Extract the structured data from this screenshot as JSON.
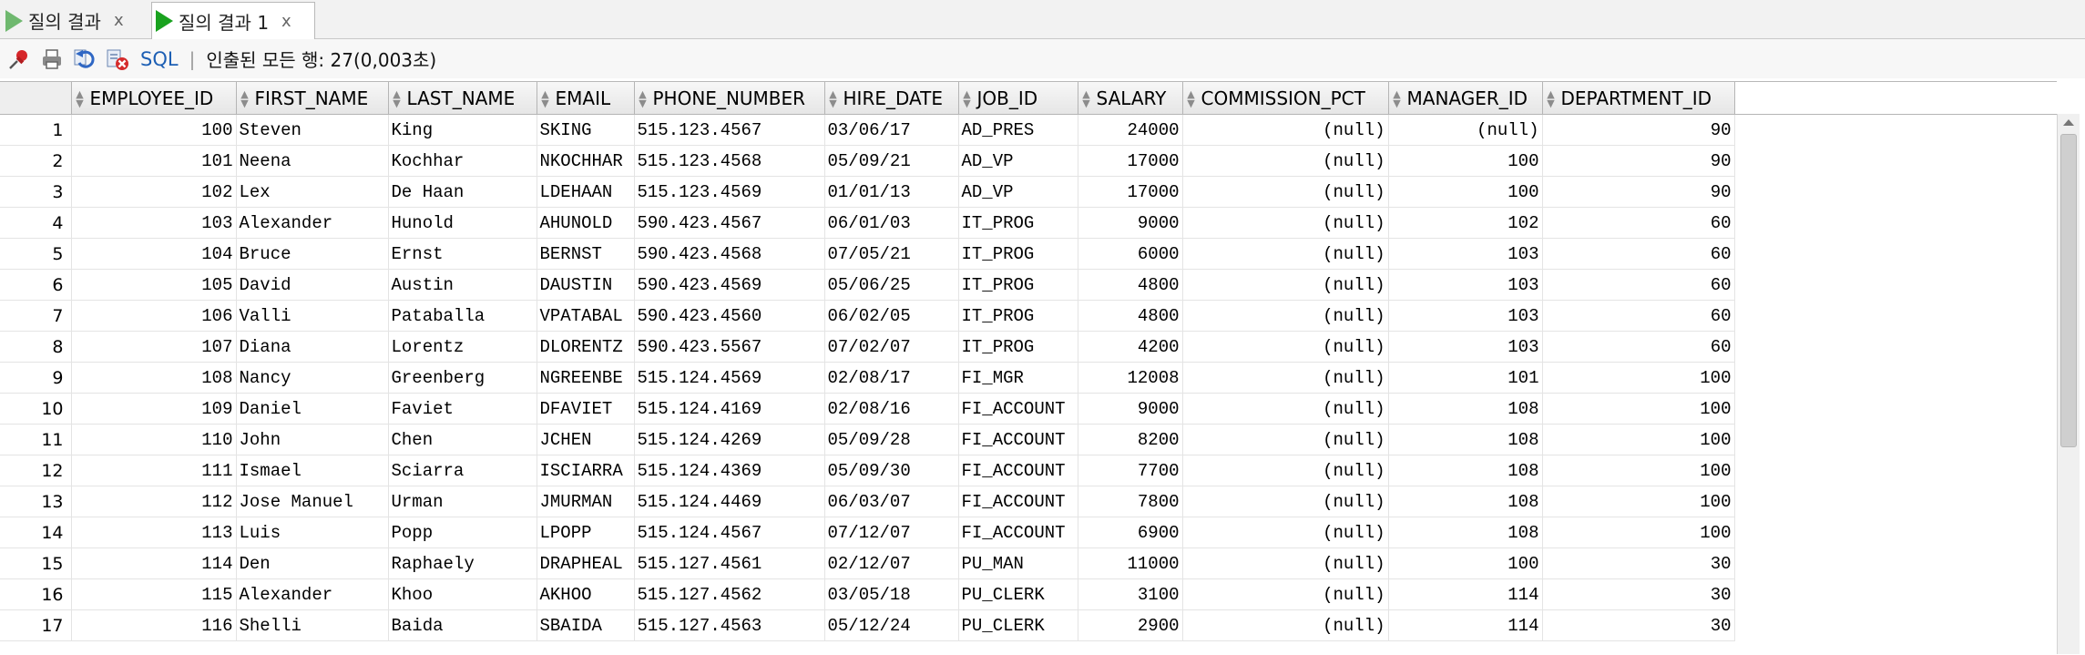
{
  "tabs": [
    {
      "label": "질의 결과",
      "close": "x"
    },
    {
      "label": "질의 결과 1",
      "close": "x"
    }
  ],
  "toolbar": {
    "sql_label": "SQL",
    "separator": "|",
    "status": "인출된 모든 행: 27(0,003초)",
    "icons": [
      "pin-icon",
      "print-icon",
      "refresh-icon",
      "clear-icon"
    ]
  },
  "grid": {
    "columns": [
      "EMPLOYEE_ID",
      "FIRST_NAME",
      "LAST_NAME",
      "EMAIL",
      "PHONE_NUMBER",
      "HIRE_DATE",
      "JOB_ID",
      "SALARY",
      "COMMISSION_PCT",
      "MANAGER_ID",
      "DEPARTMENT_ID"
    ],
    "rows": [
      [
        "1",
        "100",
        "Steven",
        "King",
        "SKING",
        "515.123.4567",
        "03/06/17",
        "AD_PRES",
        "24000",
        "(null)",
        "(null)",
        "90"
      ],
      [
        "2",
        "101",
        "Neena",
        "Kochhar",
        "NKOCHHAR",
        "515.123.4568",
        "05/09/21",
        "AD_VP",
        "17000",
        "(null)",
        "100",
        "90"
      ],
      [
        "3",
        "102",
        "Lex",
        "De Haan",
        "LDEHAAN",
        "515.123.4569",
        "01/01/13",
        "AD_VP",
        "17000",
        "(null)",
        "100",
        "90"
      ],
      [
        "4",
        "103",
        "Alexander",
        "Hunold",
        "AHUNOLD",
        "590.423.4567",
        "06/01/03",
        "IT_PROG",
        "9000",
        "(null)",
        "102",
        "60"
      ],
      [
        "5",
        "104",
        "Bruce",
        "Ernst",
        "BERNST",
        "590.423.4568",
        "07/05/21",
        "IT_PROG",
        "6000",
        "(null)",
        "103",
        "60"
      ],
      [
        "6",
        "105",
        "David",
        "Austin",
        "DAUSTIN",
        "590.423.4569",
        "05/06/25",
        "IT_PROG",
        "4800",
        "(null)",
        "103",
        "60"
      ],
      [
        "7",
        "106",
        "Valli",
        "Pataballa",
        "VPATABAL",
        "590.423.4560",
        "06/02/05",
        "IT_PROG",
        "4800",
        "(null)",
        "103",
        "60"
      ],
      [
        "8",
        "107",
        "Diana",
        "Lorentz",
        "DLORENTZ",
        "590.423.5567",
        "07/02/07",
        "IT_PROG",
        "4200",
        "(null)",
        "103",
        "60"
      ],
      [
        "9",
        "108",
        "Nancy",
        "Greenberg",
        "NGREENBE",
        "515.124.4569",
        "02/08/17",
        "FI_MGR",
        "12008",
        "(null)",
        "101",
        "100"
      ],
      [
        "10",
        "109",
        "Daniel",
        "Faviet",
        "DFAVIET",
        "515.124.4169",
        "02/08/16",
        "FI_ACCOUNT",
        "9000",
        "(null)",
        "108",
        "100"
      ],
      [
        "11",
        "110",
        "John",
        "Chen",
        "JCHEN",
        "515.124.4269",
        "05/09/28",
        "FI_ACCOUNT",
        "8200",
        "(null)",
        "108",
        "100"
      ],
      [
        "12",
        "111",
        "Ismael",
        "Sciarra",
        "ISCIARRA",
        "515.124.4369",
        "05/09/30",
        "FI_ACCOUNT",
        "7700",
        "(null)",
        "108",
        "100"
      ],
      [
        "13",
        "112",
        "Jose Manuel",
        "Urman",
        "JMURMAN",
        "515.124.4469",
        "06/03/07",
        "FI_ACCOUNT",
        "7800",
        "(null)",
        "108",
        "100"
      ],
      [
        "14",
        "113",
        "Luis",
        "Popp",
        "LPOPP",
        "515.124.4567",
        "07/12/07",
        "FI_ACCOUNT",
        "6900",
        "(null)",
        "108",
        "100"
      ],
      [
        "15",
        "114",
        "Den",
        "Raphaely",
        "DRAPHEAL",
        "515.127.4561",
        "02/12/07",
        "PU_MAN",
        "11000",
        "(null)",
        "100",
        "30"
      ],
      [
        "16",
        "115",
        "Alexander",
        "Khoo",
        "AKHOO",
        "515.127.4562",
        "03/05/18",
        "PU_CLERK",
        "3100",
        "(null)",
        "114",
        "30"
      ],
      [
        "17",
        "116",
        "Shelli",
        "Baida",
        "SBAIDA",
        "515.127.4563",
        "05/12/24",
        "PU_CLERK",
        "2900",
        "(null)",
        "114",
        "30"
      ]
    ]
  }
}
